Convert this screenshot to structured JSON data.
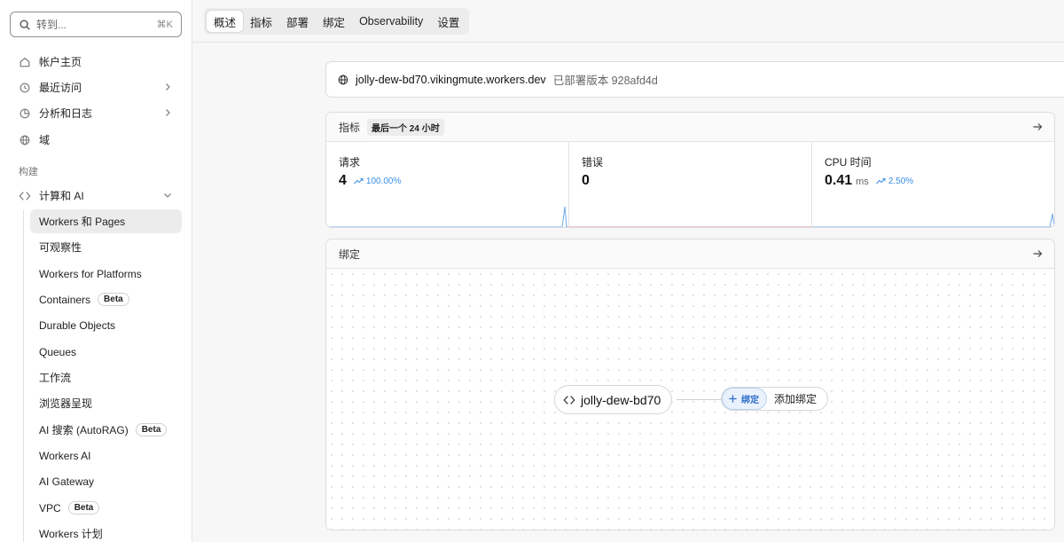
{
  "search": {
    "placeholder": "转到...",
    "shortcut": "⌘K"
  },
  "sidebar": {
    "top_items": [
      {
        "label": "帐户主页",
        "icon": "home-icon"
      },
      {
        "label": "最近访问",
        "icon": "clock-icon",
        "has_chevron": true
      },
      {
        "label": "分析和日志",
        "icon": "chart-icon",
        "has_chevron": true
      },
      {
        "label": "域",
        "icon": "globe-icon"
      }
    ],
    "section_label": "构建",
    "group": {
      "label": "计算和 AI",
      "icon": "code-diamond-icon",
      "expanded": true
    },
    "sub_items": [
      {
        "label": "Workers 和 Pages",
        "active": true
      },
      {
        "label": "可观察性"
      },
      {
        "label": "Workers for Platforms"
      },
      {
        "label": "Containers",
        "badge": "Beta"
      },
      {
        "label": "Durable Objects"
      },
      {
        "label": "Queues"
      },
      {
        "label": "工作流"
      },
      {
        "label": "浏览器呈现"
      },
      {
        "label": "AI 搜索 (AutoRAG)",
        "badge": "Beta"
      },
      {
        "label": "Workers AI"
      },
      {
        "label": "AI Gateway"
      },
      {
        "label": "VPC",
        "badge": "Beta"
      },
      {
        "label": "Workers 计划"
      }
    ]
  },
  "tabs": [
    {
      "label": "概述",
      "active": true
    },
    {
      "label": "指标"
    },
    {
      "label": "部署"
    },
    {
      "label": "绑定"
    },
    {
      "label": "Observability"
    },
    {
      "label": "设置"
    }
  ],
  "worker": {
    "hostname": "jolly-dew-bd70.vikingmute.workers.dev",
    "version_text": "已部署版本 928afd4d"
  },
  "metrics_panel": {
    "title": "指标",
    "range": "最后一个 24 小时",
    "metrics": [
      {
        "label": "请求",
        "value": "4",
        "unit": "",
        "delta": "100.00%",
        "spark_color": "#6aa9ea",
        "spike": true
      },
      {
        "label": "错误",
        "value": "0",
        "unit": "",
        "delta": "",
        "spark_color": "#e08f96",
        "spike": false
      },
      {
        "label": "CPU 时间",
        "value": "0.41",
        "unit": "ms",
        "delta": "2.50%",
        "spark_color": "#6aa9ea",
        "spike": true
      }
    ]
  },
  "bindings_panel": {
    "title": "绑定",
    "worker_node": "jolly-dew-bd70",
    "add_tag": "绑定",
    "add_label": "添加绑定"
  },
  "colors": {
    "accent": "#2f6fc9",
    "chart_blue": "#6aa9ea",
    "chart_red": "#e08f96"
  }
}
